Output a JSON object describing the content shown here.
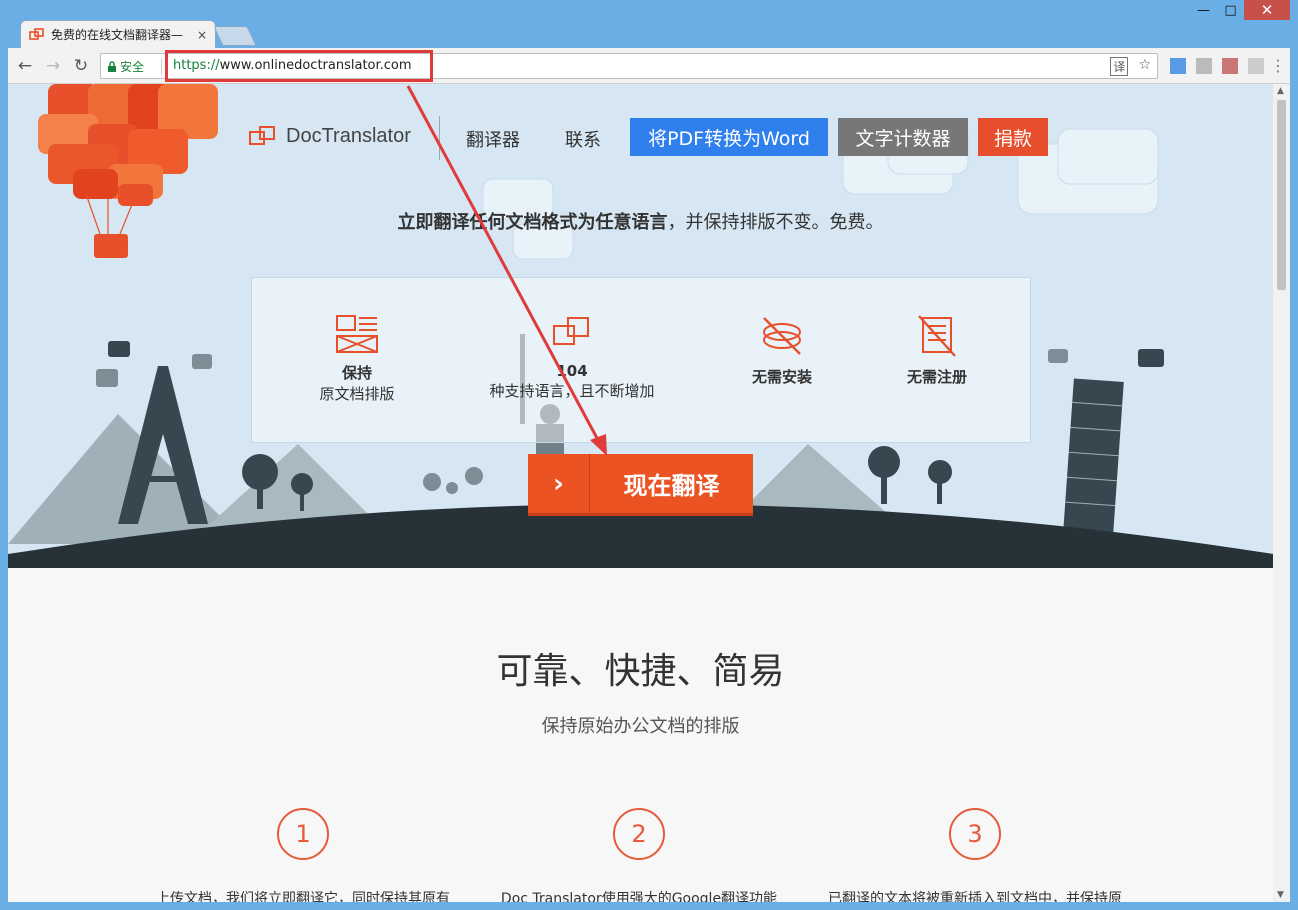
{
  "browser": {
    "tab_title": "免费的在线文档翻译器—",
    "tab_close": "×",
    "security_label": "安全",
    "url_scheme": "https://",
    "url_rest": "www.onlinedoctranslator.com",
    "window_controls": {
      "minimize": "—",
      "maximize": "□",
      "close": "✕"
    },
    "nav": {
      "back": "←",
      "forward": "→",
      "reload": "↻"
    },
    "omni_icons": {
      "translate": "译",
      "bookmark": "☆"
    },
    "menu": "⋮"
  },
  "header": {
    "brand": "DocTranslator",
    "nav_links": [
      "翻译器",
      "联系"
    ],
    "btn_pdf": "将PDF转换为Word",
    "btn_counter": "文字计数器",
    "btn_donate": "捐款"
  },
  "hero": {
    "tagline_bold": "立即翻译任何文档格式为任意语言",
    "tagline_rest": "，并保持排版不变。免费。",
    "features": [
      {
        "title": "保持",
        "desc": "原文档排版"
      },
      {
        "title": "104",
        "desc": "种支持语言，且不断增加"
      },
      {
        "title": "无需安装",
        "desc": ""
      },
      {
        "title": "无需注册",
        "desc": ""
      }
    ],
    "cta_arrow": "›",
    "cta_label": "现在翻译"
  },
  "section": {
    "title": "可靠、快捷、简易",
    "subtitle": "保持原始办公文档的排版",
    "steps": [
      {
        "num": "1",
        "text": "上传文档，我们将立即翻译它，同时保持其原有"
      },
      {
        "num": "2",
        "text": "Doc Translator使用强大的Google翻译功能"
      },
      {
        "num": "3",
        "text": "已翻译的文本将被重新插入到文档中，并保持原"
      }
    ]
  },
  "colors": {
    "accent": "#ec5323",
    "blue": "#2f80ed",
    "annotation": "#e03a3a"
  }
}
